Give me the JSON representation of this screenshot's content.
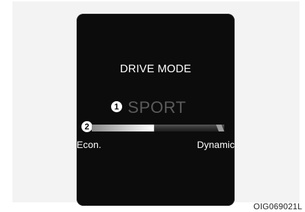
{
  "display": {
    "title": "DRIVE MODE",
    "mode": "SPORT",
    "callouts": [
      "1",
      "2"
    ],
    "scale_left": "Econ.",
    "scale_right": "Dynamic",
    "level": 0.47
  },
  "figure_code": "OIG069021L",
  "colors": {
    "display_bg": "#0c0c0c",
    "mode_text": "#5a5a5a",
    "label_text": "#ffffff",
    "bar_active": "#cfcfcf",
    "bar_inactive": "#3a3a3a"
  }
}
